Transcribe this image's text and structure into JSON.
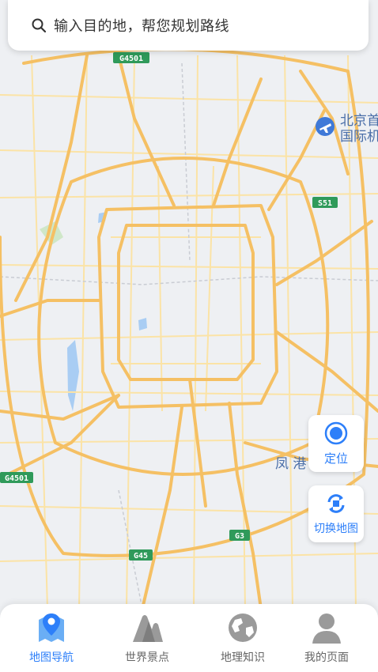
{
  "search": {
    "placeholder": "输入目的地，帮您规划路线"
  },
  "map": {
    "shields": {
      "g4501_top": "G4501",
      "s51": "S51",
      "g4501_left": "G4501",
      "g3": "G3",
      "g45": "G45"
    },
    "labels": {
      "airport_line1": "北京首",
      "airport_line2": "国际机",
      "fenggang": "凤 港"
    }
  },
  "controls": {
    "locate_label": "定位",
    "switch_label": "切换地图"
  },
  "tabs": [
    {
      "label": "地图导航",
      "icon": "map-pin-icon",
      "active": true
    },
    {
      "label": "世界景点",
      "icon": "mountain-icon",
      "active": false
    },
    {
      "label": "地理知识",
      "icon": "globe-icon",
      "active": false
    },
    {
      "label": "我的页面",
      "icon": "user-icon",
      "active": false
    }
  ],
  "colors": {
    "accent": "#2d7ff9",
    "road_major": "#f5c064",
    "road_minor": "#fbe3a6",
    "map_bg": "#eef0f3",
    "highway_shield": "#2f9a5a"
  }
}
